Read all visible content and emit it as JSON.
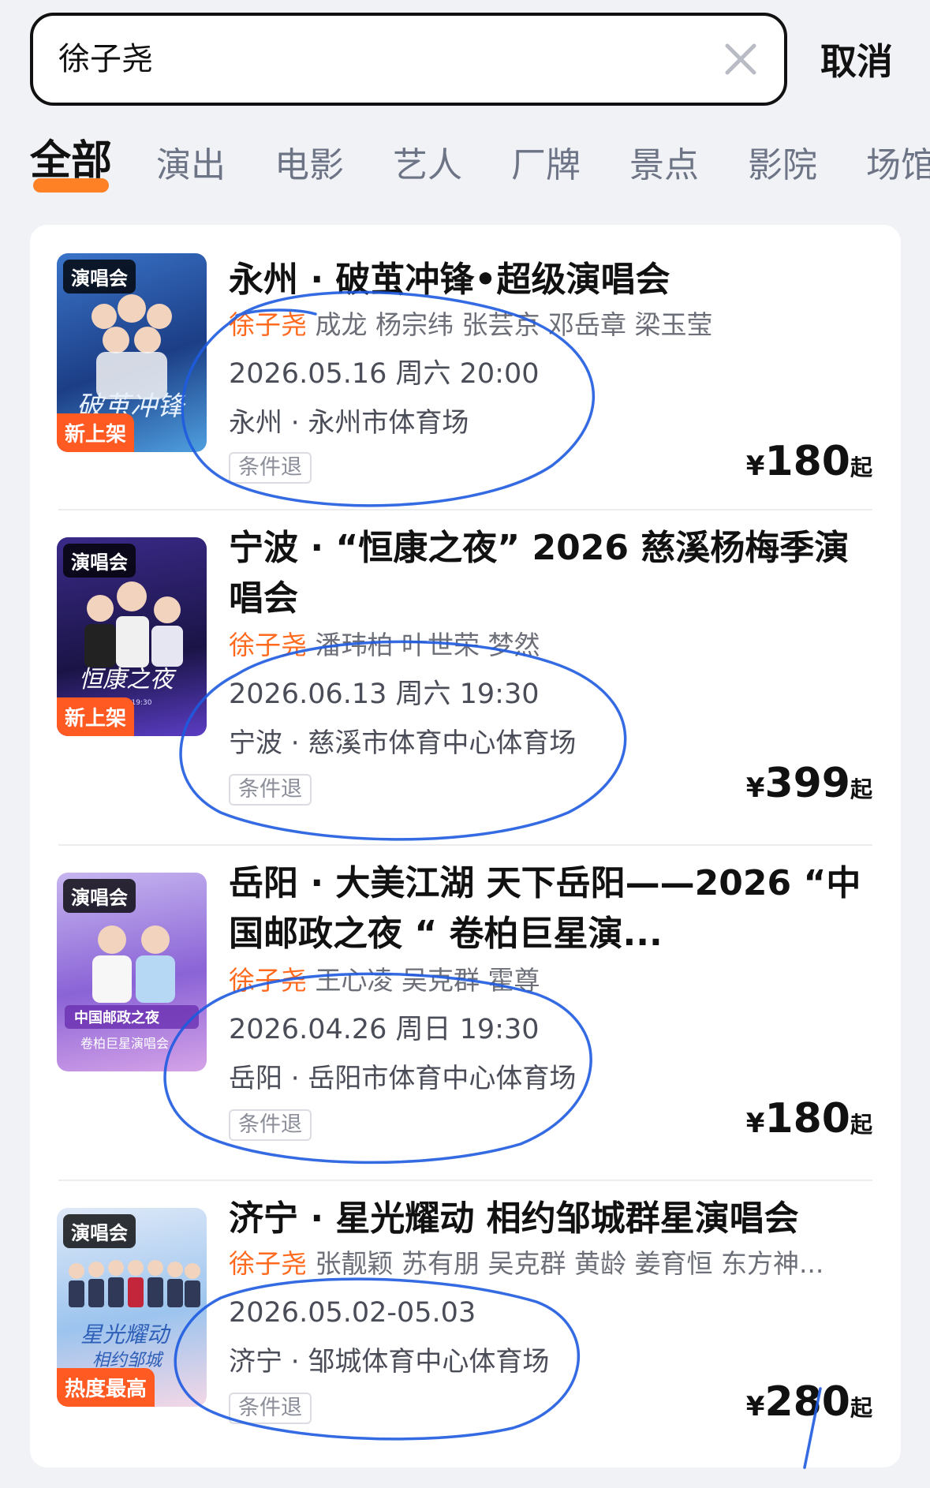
{
  "search": {
    "query": "徐子尧"
  },
  "cancel_label": "取消",
  "tabs": [
    {
      "label": "全部"
    },
    {
      "label": "演出"
    },
    {
      "label": "电影"
    },
    {
      "label": "艺人"
    },
    {
      "label": "厂牌"
    },
    {
      "label": "景点"
    },
    {
      "label": "影院"
    },
    {
      "label": "场馆"
    }
  ],
  "results": [
    {
      "tag": "演唱会",
      "badge": "新上架",
      "title": "永州 · 破茧冲锋•超级演唱会",
      "artist_highlight": "徐子尧",
      "artists_rest": " 成龙 杨宗纬 张芸京 邓岳章 梁玉莹",
      "date": "2026.05.16 周六 20:00",
      "venue": "永州 · 永州市体育场",
      "refund": "条件退",
      "price_currency": "¥",
      "price": "180",
      "price_suffix": "起"
    },
    {
      "tag": "演唱会",
      "badge": "新上架",
      "title": "宁波 · “恒康之夜” 2026 慈溪杨梅季演唱会",
      "artist_highlight": "徐子尧",
      "artists_rest": " 潘玮柏 叶世荣 梦然",
      "date": "2026.06.13 周六 19:30",
      "venue": "宁波 · 慈溪市体育中心体育场",
      "refund": "条件退",
      "price_currency": "¥",
      "price": "399",
      "price_suffix": "起"
    },
    {
      "tag": "演唱会",
      "badge": "",
      "title": "岳阳 · 大美江湖 天下岳阳——2026 “中国邮政之夜 “ 卷柏巨星演...",
      "artist_highlight": "徐子尧",
      "artists_rest": " 王心凌 吴克群 霍尊",
      "date": "2026.04.26 周日 19:30",
      "venue": "岳阳 · 岳阳市体育中心体育场",
      "refund": "条件退",
      "price_currency": "¥",
      "price": "180",
      "price_suffix": "起"
    },
    {
      "tag": "演唱会",
      "badge": "热度最高",
      "title": "济宁 · 星光耀动 相约邹城群星演唱会",
      "artist_highlight": "徐子尧",
      "artists_rest": " 张靓颖 苏有朋 吴克群 黄龄 姜育恒 东方神...",
      "date": "2026.05.02-05.03",
      "venue": "济宁 · 邹城体育中心体育场",
      "refund": "条件退",
      "price_currency": "¥",
      "price": "280",
      "price_suffix": "起"
    }
  ],
  "colors": {
    "accent": "#ff6a1f",
    "badge": "#ff5a22",
    "annotation": "#1e5be0"
  }
}
